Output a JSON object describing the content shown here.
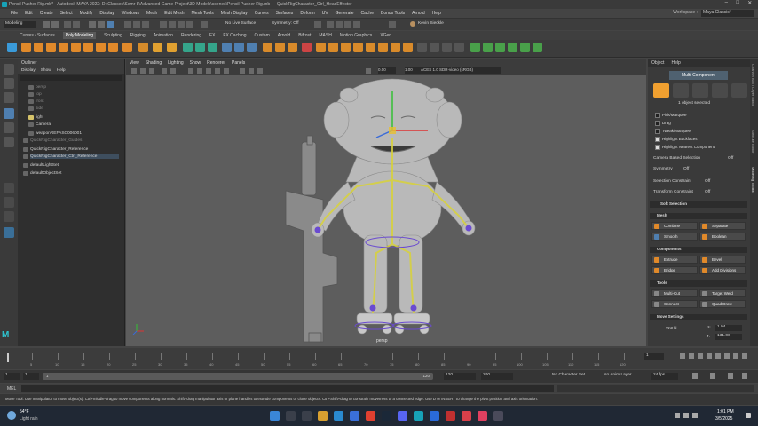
{
  "window": {
    "title": "Pencil Pusher Rig.mb* - Autodesk MAYA 2022: D:\\Classes\\Semr 8\\Advanced Game Project\\3D Models\\scenes\\Pencil Pusher Rig.mb  ---  QuickRigCharacter_Ctrl_HeadEffector",
    "minimize": "–",
    "maximize": "□",
    "close": "✕"
  },
  "menubar": {
    "items": [
      "File",
      "Edit",
      "Create",
      "Select",
      "Modify",
      "Display",
      "Windows",
      "Mesh",
      "Edit Mesh",
      "Mesh Tools",
      "Mesh Display",
      "Curves",
      "Surfaces",
      "Deform",
      "UV",
      "Generate",
      "Cache",
      "Bonus Tools",
      "Arnold",
      "Help"
    ],
    "workspace_label": "Workspace :",
    "workspace_value": "Maya Classic*"
  },
  "statusline": {
    "mode": "Modeling",
    "live_surface": "No Live Surface",
    "symmetry": "Symmetry: Off",
    "user": "Kevin Sieckle"
  },
  "shelf_tabs": [
    "Curves / Surfaces",
    "Poly Modeling",
    "Sculpting",
    "Rigging",
    "Animation",
    "Rendering",
    "FX",
    "FX Caching",
    "Custom",
    "Arnold",
    "Bifrost",
    "MASH",
    "Motion Graphics",
    "XGen"
  ],
  "shelf_active": "Poly Modeling",
  "outliner": {
    "title": "Outliner",
    "menus": [
      "Display",
      "Show",
      "Help"
    ],
    "items": [
      {
        "label": "persp",
        "dim": true
      },
      {
        "label": "top",
        "dim": true
      },
      {
        "label": "front",
        "dim": true
      },
      {
        "label": "side",
        "dim": true
      },
      {
        "label": "light",
        "dim": false
      },
      {
        "label": "Camera",
        "dim": false
      },
      {
        "label": "weaponREFASC006001",
        "dim": false
      },
      {
        "label": "QuickRigCharacter_Guides",
        "dim": true
      },
      {
        "label": "QuickRigCharacter_Reference",
        "dim": false
      },
      {
        "label": "QuickRigCharacter_Ctrl_Reference",
        "dim": false
      },
      {
        "label": "defaultLightSet",
        "dim": false
      },
      {
        "label": "defaultObjectSet",
        "dim": false
      }
    ]
  },
  "viewport": {
    "menus": [
      "View",
      "Shading",
      "Lighting",
      "Show",
      "Renderer",
      "Panels"
    ],
    "field1": "0.00",
    "field2": "1.00",
    "colorspace": "ACES 1.0 SDR-video (sRGB)",
    "camera_label": "persp"
  },
  "attribute_panel": {
    "tabs": [
      "Object",
      "Help"
    ],
    "mode_tab": "Multi-Component",
    "selected_text": "1 object selected",
    "pick_options": [
      {
        "label": "Pick/Marquee",
        "checked": false
      },
      {
        "label": "Drag",
        "checked": false
      },
      {
        "label": "Tweak/Marquee",
        "checked": false
      },
      {
        "label": "Highlight Backfaces",
        "checked": true
      },
      {
        "label": "Highlight Nearest Component",
        "checked": true
      }
    ],
    "camera_based_selection": {
      "label": "Camera Based Selection",
      "value": "Off"
    },
    "symmetry": {
      "label": "Symmetry",
      "value": "Off"
    },
    "selection_constraint": {
      "label": "Selection Constraint",
      "value": "Off"
    },
    "transform_constraint": {
      "label": "Transform Constraint",
      "value": "Off"
    },
    "soft_selection": "Soft Selection",
    "sections": {
      "mesh": {
        "title": "Mesh",
        "buttons": [
          "Combine",
          "Separate",
          "Smooth",
          "Boolean"
        ]
      },
      "components": {
        "title": "Components",
        "buttons": [
          "Extrude",
          "Bevel",
          "Bridge",
          "Add Divisions"
        ]
      },
      "tools": {
        "title": "Tools",
        "buttons": [
          "Multi-Cut",
          "Target Weld",
          "Connect",
          "Quad Draw"
        ]
      },
      "move": {
        "title": "Move Settings",
        "world_label": "World",
        "x_label": "X:",
        "x_value": "1.94",
        "y_label": "Y:",
        "y_value": "131.06"
      }
    },
    "side_tabs": [
      "Channel Box / Layer Editor",
      "Attribute Editor",
      "Modeling Toolkit"
    ]
  },
  "timeline": {
    "ticks": [
      "5",
      "10",
      "15",
      "20",
      "25",
      "30",
      "35",
      "40",
      "45",
      "50",
      "55",
      "60",
      "65",
      "70",
      "75",
      "80",
      "85",
      "90",
      "95",
      "100",
      "105",
      "110",
      "115",
      "120"
    ],
    "current_frame": "1"
  },
  "range": {
    "start": "1",
    "start2": "1",
    "range_end_inner": "120",
    "end_inner": "120",
    "end": "200",
    "char_set": "No Character Set",
    "anim_layer": "No Anim Layer",
    "fps": "24 fps"
  },
  "mel": {
    "label": "MEL"
  },
  "help_line": "Move Tool: Use manipulator to move object(s). Ctrl+middle-drag to move components along normals. Shift+drag manipulator axis or plane handles to extrude components or clone objects. Ctrl+Shift+drag to constrain movement to a connected edge. Use D or INSERT to change the pivot position and axis orientation.",
  "taskbar": {
    "temp": "54°F",
    "weather": "Light rain",
    "time": "1:01 PM",
    "date": "3/5/2025"
  },
  "colors": {
    "accent": "#f0a030",
    "joint": "#d8d23a",
    "ctrl": "#6a4bd0",
    "active_blue": "#4f7fb0"
  }
}
